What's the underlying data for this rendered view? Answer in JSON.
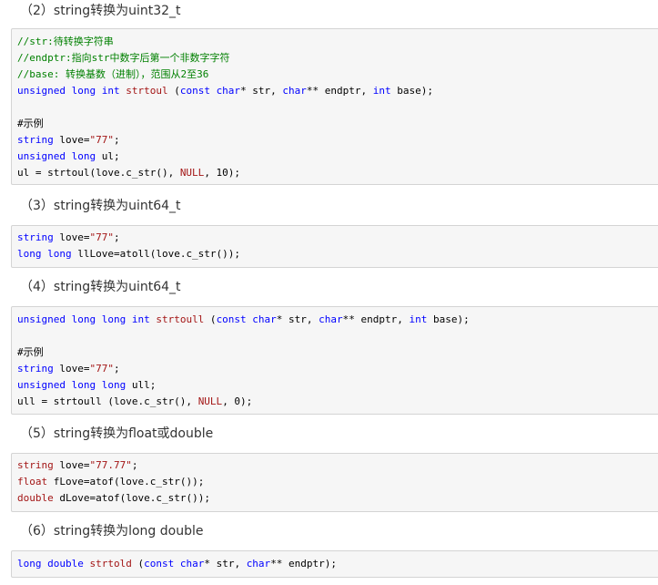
{
  "sections": [
    {
      "heading": "（2）string转换为uint32_t",
      "code": [
        [
          {
            "t": "//str:待转换字符串",
            "c": "cm"
          }
        ],
        [
          {
            "t": "//endptr:指向str中数字后第一个非数字字符",
            "c": "cm"
          }
        ],
        [
          {
            "t": "//base: 转换基数（进制），范围从2至36",
            "c": "cm"
          }
        ],
        [
          {
            "t": "unsigned long int ",
            "c": "kw"
          },
          {
            "t": "strtoul",
            "c": "fn"
          },
          {
            "t": " (",
            "c": "txt"
          },
          {
            "t": "const char",
            "c": "kw"
          },
          {
            "t": "* str, ",
            "c": "txt"
          },
          {
            "t": "char",
            "c": "kw"
          },
          {
            "t": "** endptr, ",
            "c": "txt"
          },
          {
            "t": "int",
            "c": "kw"
          },
          {
            "t": " base);",
            "c": "txt"
          }
        ],
        [],
        [
          {
            "t": "#示例",
            "c": "txt"
          }
        ],
        [
          {
            "t": "string",
            "c": "kw"
          },
          {
            "t": " love=",
            "c": "txt"
          },
          {
            "t": "\"77\"",
            "c": "str"
          },
          {
            "t": ";",
            "c": "txt"
          }
        ],
        [
          {
            "t": "unsigned long",
            "c": "kw"
          },
          {
            "t": " ul;",
            "c": "txt"
          }
        ],
        [
          {
            "t": "ul = strtoul(love.c_str(), ",
            "c": "txt"
          },
          {
            "t": "NULL",
            "c": "nl"
          },
          {
            "t": ", 10);",
            "c": "txt"
          }
        ]
      ]
    },
    {
      "heading": "（3）string转换为uint64_t",
      "code": [
        [
          {
            "t": "string",
            "c": "kw"
          },
          {
            "t": " love=",
            "c": "txt"
          },
          {
            "t": "\"77\"",
            "c": "str"
          },
          {
            "t": ";",
            "c": "txt"
          }
        ],
        [
          {
            "t": "long long",
            "c": "kw"
          },
          {
            "t": " llLove=atoll(love.c_str());",
            "c": "txt"
          }
        ]
      ]
    },
    {
      "heading": "（4）string转换为uint64_t",
      "code": [
        [
          {
            "t": "unsigned long long int ",
            "c": "kw"
          },
          {
            "t": "strtoull",
            "c": "fn"
          },
          {
            "t": " (",
            "c": "txt"
          },
          {
            "t": "const char",
            "c": "kw"
          },
          {
            "t": "* str, ",
            "c": "txt"
          },
          {
            "t": "char",
            "c": "kw"
          },
          {
            "t": "** endptr, ",
            "c": "txt"
          },
          {
            "t": "int",
            "c": "kw"
          },
          {
            "t": " base);",
            "c": "txt"
          }
        ],
        [],
        [
          {
            "t": "#示例",
            "c": "txt"
          }
        ],
        [
          {
            "t": "string",
            "c": "kw"
          },
          {
            "t": " love=",
            "c": "txt"
          },
          {
            "t": "\"77\"",
            "c": "str"
          },
          {
            "t": ";",
            "c": "txt"
          }
        ],
        [
          {
            "t": "unsigned long long",
            "c": "kw"
          },
          {
            "t": " ull;",
            "c": "txt"
          }
        ],
        [
          {
            "t": "ull = strtoull (love.c_str(), ",
            "c": "txt"
          },
          {
            "t": "NULL",
            "c": "nl"
          },
          {
            "t": ", 0);",
            "c": "txt"
          }
        ]
      ]
    },
    {
      "heading": "（5）string转换为float或double",
      "code": [
        [
          {
            "t": "string",
            "c": "fn"
          },
          {
            "t": " love=",
            "c": "txt"
          },
          {
            "t": "\"77.77\"",
            "c": "str"
          },
          {
            "t": ";",
            "c": "txt"
          }
        ],
        [
          {
            "t": "float",
            "c": "fn"
          },
          {
            "t": " fLove=atof(love.c_str());",
            "c": "txt"
          }
        ],
        [
          {
            "t": "double",
            "c": "fn"
          },
          {
            "t": " dLove=atof(love.c_str());",
            "c": "txt"
          }
        ]
      ]
    },
    {
      "heading": "（6）string转换为long double",
      "code": [
        [
          {
            "t": "long double ",
            "c": "kw"
          },
          {
            "t": "strtold",
            "c": "fn"
          },
          {
            "t": " (",
            "c": "txt"
          },
          {
            "t": "const char",
            "c": "kw"
          },
          {
            "t": "* str, ",
            "c": "txt"
          },
          {
            "t": "char",
            "c": "kw"
          },
          {
            "t": "** endptr);",
            "c": "txt"
          }
        ]
      ]
    }
  ]
}
